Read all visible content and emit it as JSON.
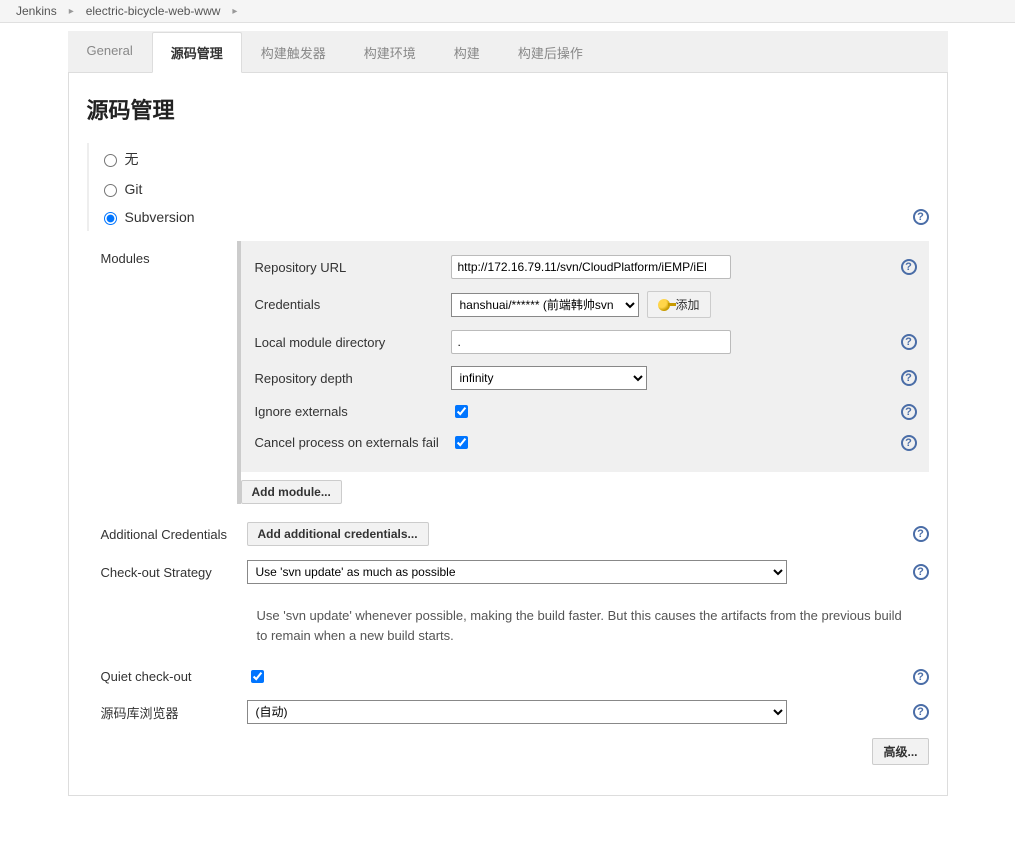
{
  "breadcrumb": {
    "root": "Jenkins",
    "project": "electric-bicycle-web-www"
  },
  "tabs": {
    "general": "General",
    "scm": "源码管理",
    "triggers": "构建触发器",
    "buildenv": "构建环境",
    "build": "构建",
    "postbuild": "构建后操作"
  },
  "section": {
    "title": "源码管理"
  },
  "scm_options": {
    "none": "无",
    "git": "Git",
    "svn": "Subversion"
  },
  "modules": {
    "label": "Modules",
    "repo_url_label": "Repository URL",
    "repo_url_value": "http://172.16.79.11/svn/CloudPlatform/iEMP/iEl",
    "credentials_label": "Credentials",
    "credentials_selected": "hanshuai/****** (前端韩帅svn",
    "add_btn": "添加",
    "local_dir_label": "Local module directory",
    "local_dir_value": ".",
    "repo_depth_label": "Repository depth",
    "repo_depth_value": "infinity",
    "ignore_externals_label": "Ignore externals",
    "cancel_on_fail_label": "Cancel process on externals fail",
    "add_module_btn": "Add module..."
  },
  "additional_credentials": {
    "label": "Additional Credentials",
    "btn": "Add additional credentials..."
  },
  "checkout_strategy": {
    "label": "Check-out Strategy",
    "selected": "Use 'svn update' as much as possible",
    "hint": "Use 'svn update' whenever possible, making the build faster. But this causes the artifacts from the previous build to remain when a new build starts."
  },
  "quiet_checkout": {
    "label": "Quiet check-out"
  },
  "repo_browser": {
    "label": "源码库浏览器",
    "selected": "(自动)"
  },
  "advanced_btn": "高级..."
}
